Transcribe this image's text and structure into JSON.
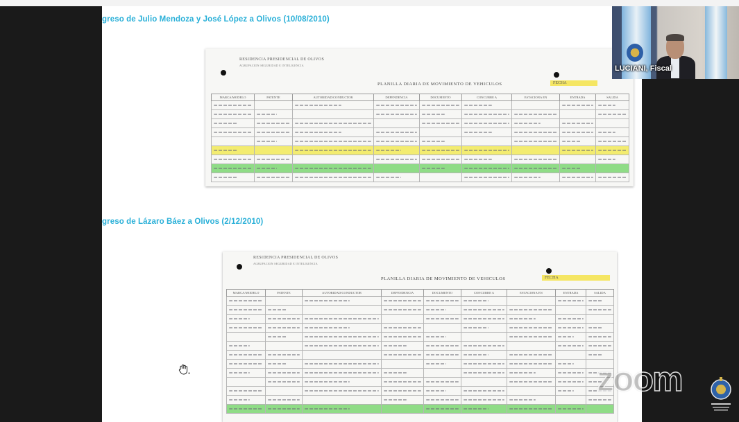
{
  "slide": {
    "heading_1": "greso de Julio Mendoza y José López a Olivos (10/08/2010)",
    "heading_2": "greso de Lázaro Báez a Olivos (2/12/2010)",
    "documents": [
      {
        "header_line_1": "RESIDENCIA PRESIDENCIAL DE OLIVOS",
        "header_line_2": "AGRUPACION SEGURIDAD E INTELIGENCIA",
        "planilla_title": "PLANILLA DIARIA DE MOVIMIENTO DE VEHICULOS",
        "fecha_label": "FECHA",
        "columns": [
          "MARCA/MODELO",
          "PATENTE",
          "AUTORIDAD/CONDUCTOR",
          "DEPENDENCIA",
          "DOCUMENTO",
          "CONCURRE A",
          "ESTACIONA EN",
          "ENTRADA",
          "SALIDA"
        ],
        "row_count": 9,
        "highlight_yellow_row": 6,
        "highlight_green_row": 8
      },
      {
        "header_line_1": "RESIDENCIA PRESIDENCIAL DE OLIVOS",
        "header_line_2": "AGRUPACION SEGURIDAD E INTELIGENCIA",
        "planilla_title": "PLANILLA DIARIA DE MOVIMIENTO DE VEHICULOS",
        "fecha_label": "FECHA",
        "columns": [
          "MARCA/MODELO",
          "PATENTE",
          "AUTORIDAD/CONDUCTOR",
          "DEPENDENCIA",
          "DOCUMENTO",
          "CONCURRE A",
          "ESTACIONA EN",
          "ENTRADA",
          "SALIDA"
        ],
        "row_count": 13,
        "highlight_green_row": 13
      }
    ]
  },
  "video_thumbnail": {
    "participant_name": "LUCIANI, Fiscal"
  },
  "watermark": {
    "brand": "zoom"
  },
  "colors": {
    "heading": "#2ab0d8",
    "yellow_highlight": "#f3ec70",
    "green_highlight": "#8fdc86"
  },
  "icons": {
    "cursor": "grab-hand-icon",
    "seal": "court-seal-icon"
  }
}
